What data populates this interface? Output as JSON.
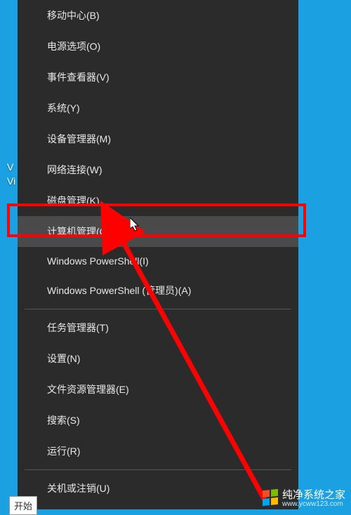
{
  "desktop": {
    "text1": "V",
    "text2": "Vi"
  },
  "menu": {
    "groups": [
      [
        {
          "id": "mobility-center",
          "label": "移动中心(B)"
        },
        {
          "id": "power-options",
          "label": "电源选项(O)"
        },
        {
          "id": "event-viewer",
          "label": "事件查看器(V)"
        },
        {
          "id": "system",
          "label": "系统(Y)"
        },
        {
          "id": "device-manager",
          "label": "设备管理器(M)"
        },
        {
          "id": "network-connections",
          "label": "网络连接(W)"
        },
        {
          "id": "disk-management",
          "label": "磁盘管理(K)"
        },
        {
          "id": "computer-management",
          "label": "计算机管理(G)",
          "highlighted": true
        },
        {
          "id": "powershell",
          "label": "Windows PowerShell(I)"
        },
        {
          "id": "powershell-admin",
          "label": "Windows PowerShell (管理员)(A)"
        }
      ],
      [
        {
          "id": "task-manager",
          "label": "任务管理器(T)"
        },
        {
          "id": "settings",
          "label": "设置(N)"
        },
        {
          "id": "file-explorer",
          "label": "文件资源管理器(E)"
        },
        {
          "id": "search",
          "label": "搜索(S)"
        },
        {
          "id": "run",
          "label": "运行(R)"
        }
      ],
      [
        {
          "id": "shutdown-signout",
          "label": "关机或注销(U)"
        }
      ]
    ]
  },
  "start_label": "开始",
  "watermark": {
    "title": "纯净系统之家",
    "url": "www.ycww123.com"
  }
}
